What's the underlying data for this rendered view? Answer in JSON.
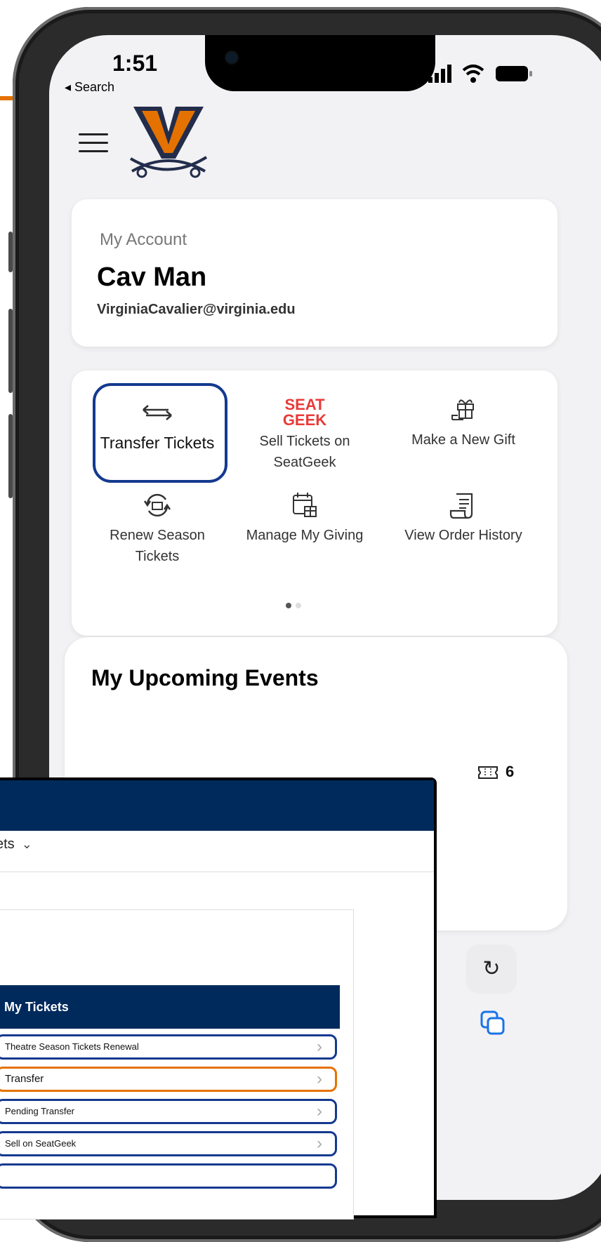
{
  "colors": {
    "accent_orange": "#e57200",
    "navy": "#002a5c",
    "highlight_blue": "#14398f"
  },
  "status_bar": {
    "time": "1:51",
    "back_label": "◂ Search"
  },
  "account": {
    "label": "My Account",
    "name": "Cav Man",
    "email": "VirginiaCavalier@virginia.edu"
  },
  "actions": [
    {
      "label": "Transfer Tickets",
      "icon": "transfer-arrows-icon"
    },
    {
      "label": "Sell Tickets on SeatGeek",
      "icon": "seatgeek-logo"
    },
    {
      "label": "Make a New Gift",
      "icon": "gift-icon"
    },
    {
      "label": "Renew Season Tickets",
      "icon": "renew-icon"
    },
    {
      "label": "Manage My Giving",
      "icon": "calendar-gift-icon"
    },
    {
      "label": "View Order History",
      "icon": "receipt-icon"
    }
  ],
  "seatgeek_logo": {
    "line1": "SEAT",
    "line2": "GEEK"
  },
  "pagination": {
    "pages": 2,
    "current": 1
  },
  "events": {
    "title": "My Upcoming Events",
    "ticket_count": "6"
  },
  "overlay": {
    "tab_label": "ets",
    "tickets_header": "My Tickets",
    "items": [
      {
        "label": "Theatre Season Tickets Renewal",
        "active": false
      },
      {
        "label": "Transfer",
        "active": true
      },
      {
        "label": "Pending Transfer",
        "active": false
      },
      {
        "label": "Sell on SeatGeek",
        "active": false
      },
      {
        "label": "",
        "active": false
      }
    ]
  }
}
